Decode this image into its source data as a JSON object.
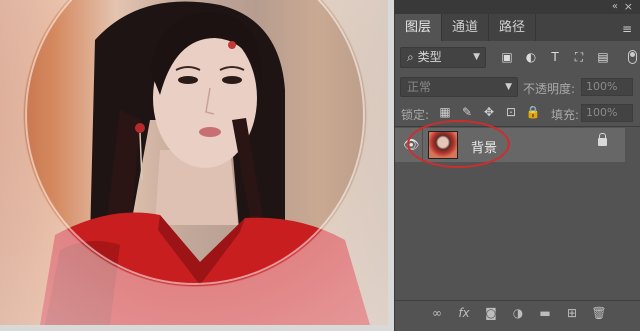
{
  "layers_panel": {
    "collapse_icon": "double-chevron-icon",
    "tabs": [
      {
        "label": "图层",
        "active": true
      },
      {
        "label": "通道",
        "active": false
      },
      {
        "label": "路径",
        "active": false
      }
    ],
    "filter": {
      "label": "类型",
      "icons": [
        "image-filter-icon",
        "adjustment-filter-icon",
        "type-filter-icon",
        "shape-filter-icon",
        "smart-object-filter-icon"
      ]
    },
    "blend_mode": "正常",
    "opacity_label": "不透明度:",
    "opacity_value": "100%",
    "lock_label": "锁定:",
    "fill_label": "填充:",
    "fill_value": "100%",
    "layers": [
      {
        "name": "背景",
        "visible": true,
        "locked": true,
        "highlighted": true
      }
    ],
    "bottom_icons": [
      "link-icon",
      "fx-icon",
      "mask-icon",
      "adjustment-icon",
      "group-folder-icon",
      "new-layer-icon",
      "trash-icon"
    ]
  },
  "colors": {
    "panel_bg": "#535353",
    "highlight_ring": "#d12c2c"
  }
}
